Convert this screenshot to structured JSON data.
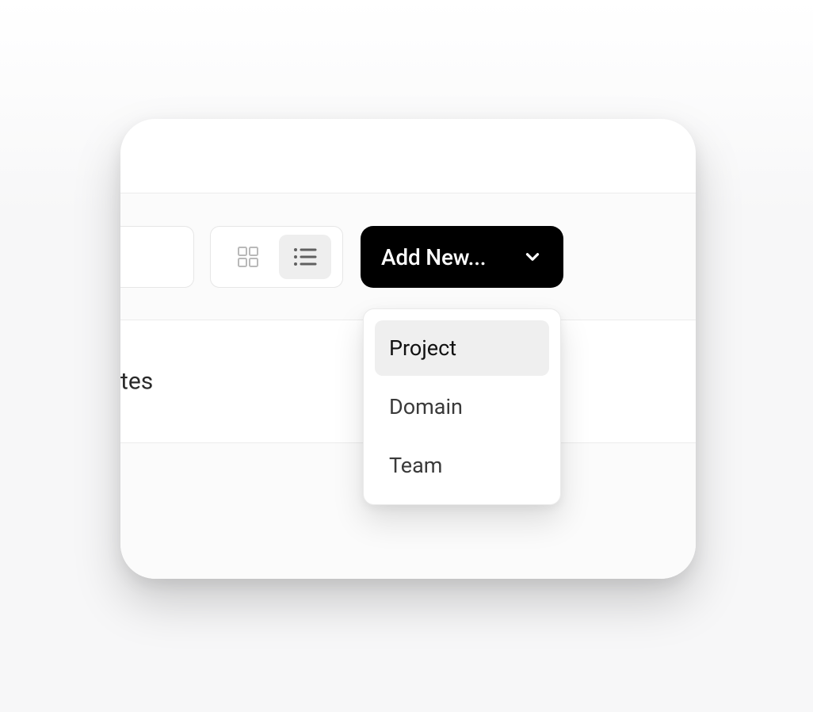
{
  "toolbar": {
    "add_new_label": "Add New..."
  },
  "dropdown": {
    "items": [
      {
        "label": "Project",
        "hover": true
      },
      {
        "label": "Domain",
        "hover": false
      },
      {
        "label": "Team",
        "hover": false
      }
    ]
  },
  "section": {
    "truncated_label": "tes"
  }
}
